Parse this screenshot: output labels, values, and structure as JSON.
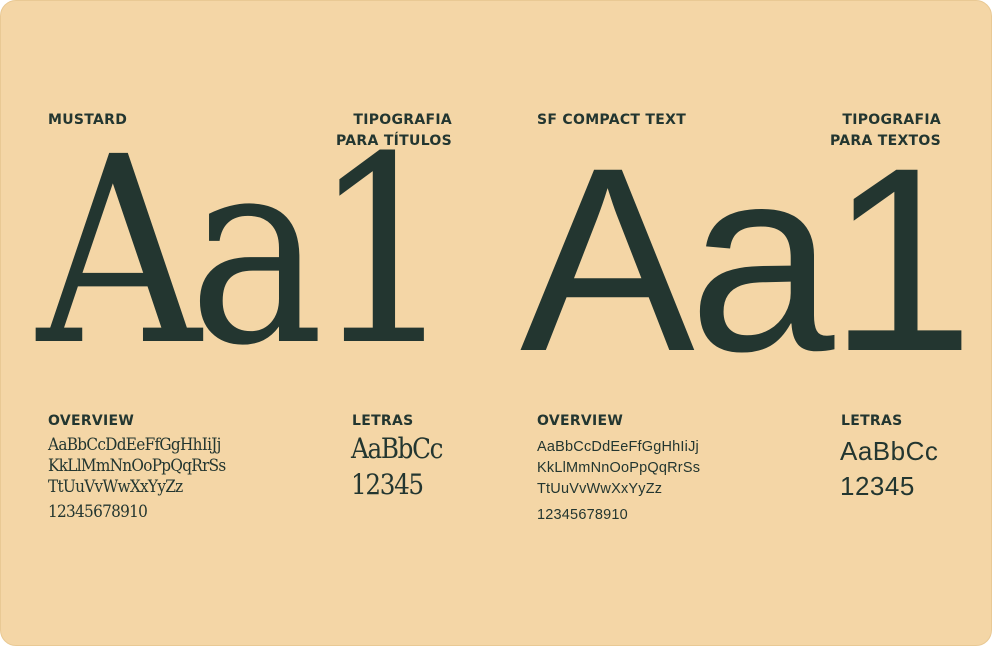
{
  "fonts": [
    {
      "name": "MUSTARD",
      "purpose": "TIPOGRAFIA\nPARA TÍTULOS",
      "specimen": "Aa1",
      "overview_label": "OVERVIEW",
      "overview_lines": [
        "AaBbCcDdEeFfGgHhIiJj",
        "KkLlMmNnOoPpQqRrSs",
        "TtUuVvWwXxYyZz"
      ],
      "overview_digits": "12345678910",
      "letters_label": "LETRAS",
      "letters_sample": "AaBbCc",
      "letters_digits": "12345"
    },
    {
      "name": "SF COMPACT TEXT",
      "purpose": "TIPOGRAFIA\nPARA TEXTOS",
      "specimen": "Aa1",
      "overview_label": "OVERVIEW",
      "overview_lines": [
        "AaBbCcDdEeFfGgHhIiJj",
        "KkLlMmNnOoPpQqRrSs",
        "TtUuVvWwXxYyZz"
      ],
      "overview_digits": "12345678910",
      "letters_label": "LETRAS",
      "letters_sample": "AaBbCc",
      "letters_digits": "12345"
    }
  ],
  "colors": {
    "background": "#f4d6a6",
    "ink": "#233630"
  }
}
